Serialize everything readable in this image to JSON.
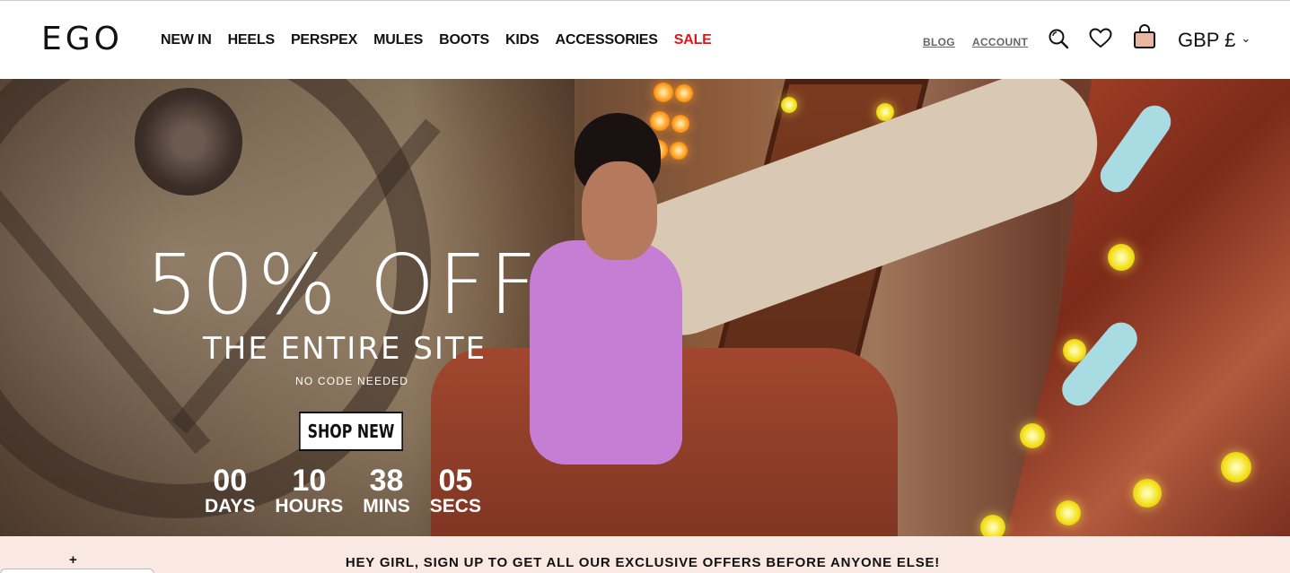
{
  "brand": {
    "logo": "EGO"
  },
  "nav": {
    "items": [
      {
        "label": "NEW IN"
      },
      {
        "label": "HEELS"
      },
      {
        "label": "PERSPEX"
      },
      {
        "label": "MULES"
      },
      {
        "label": "BOOTS"
      },
      {
        "label": "KIDS"
      },
      {
        "label": "ACCESSORIES"
      },
      {
        "label": "SALE"
      }
    ],
    "sale_color": "#e0161b"
  },
  "utility": {
    "blog": "BLOG",
    "account": "ACCOUNT",
    "currency": "GBP £",
    "icons": [
      "search-icon",
      "heart-icon",
      "bag-icon",
      "chevron-down-icon"
    ]
  },
  "hero": {
    "headline": "50% OFF",
    "subheadline": "THE ENTIRE SITE",
    "note": "NO CODE NEEDED",
    "cta": "SHOP NEW",
    "countdown": [
      {
        "value": "00",
        "label": "DAYS"
      },
      {
        "value": "10",
        "label": "HOURS"
      },
      {
        "value": "38",
        "label": "MINS"
      },
      {
        "value": "05",
        "label": "SECS"
      }
    ]
  },
  "signup": {
    "text": "HEY GIRL, SIGN UP TO GET ALL OUR EXCLUSIVE OFFERS BEFORE ANYONE ELSE!",
    "plus": "+",
    "background": "#fae9e2"
  }
}
